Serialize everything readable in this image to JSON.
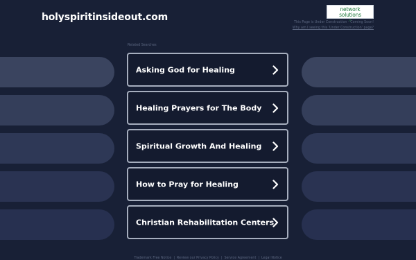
{
  "header": {
    "domain": "holyspiritinsideout.com",
    "logo": {
      "line1": "network",
      "line2": "solutions",
      "registered_mark": "®"
    },
    "under_construction": "This Page is Under Construction - Coming Soon!",
    "why_link": "Why am I seeing this 'Under Construction' page?"
  },
  "related": {
    "heading": "Related Searches",
    "links": [
      {
        "label": "Asking God for Healing",
        "icon": "chevron-right-icon"
      },
      {
        "label": "Healing Prayers for The Body",
        "icon": "chevron-right-icon"
      },
      {
        "label": "Spiritual Growth And Healing",
        "icon": "chevron-right-icon"
      },
      {
        "label": "How to Pray for Healing",
        "icon": "chevron-right-icon"
      },
      {
        "label": "Christian Rehabilitation Centers",
        "icon": "chevron-right-icon"
      }
    ]
  },
  "footer": {
    "links": [
      "Trademark Free Notice",
      "Review our Privacy Policy",
      "Service Agreement",
      "Legal Notice"
    ],
    "separator": "|"
  },
  "colors": {
    "background": "#182036",
    "button_border": "#a6aebe",
    "logo_green": "#1e7a3c",
    "muted_text": "#5c6781"
  }
}
